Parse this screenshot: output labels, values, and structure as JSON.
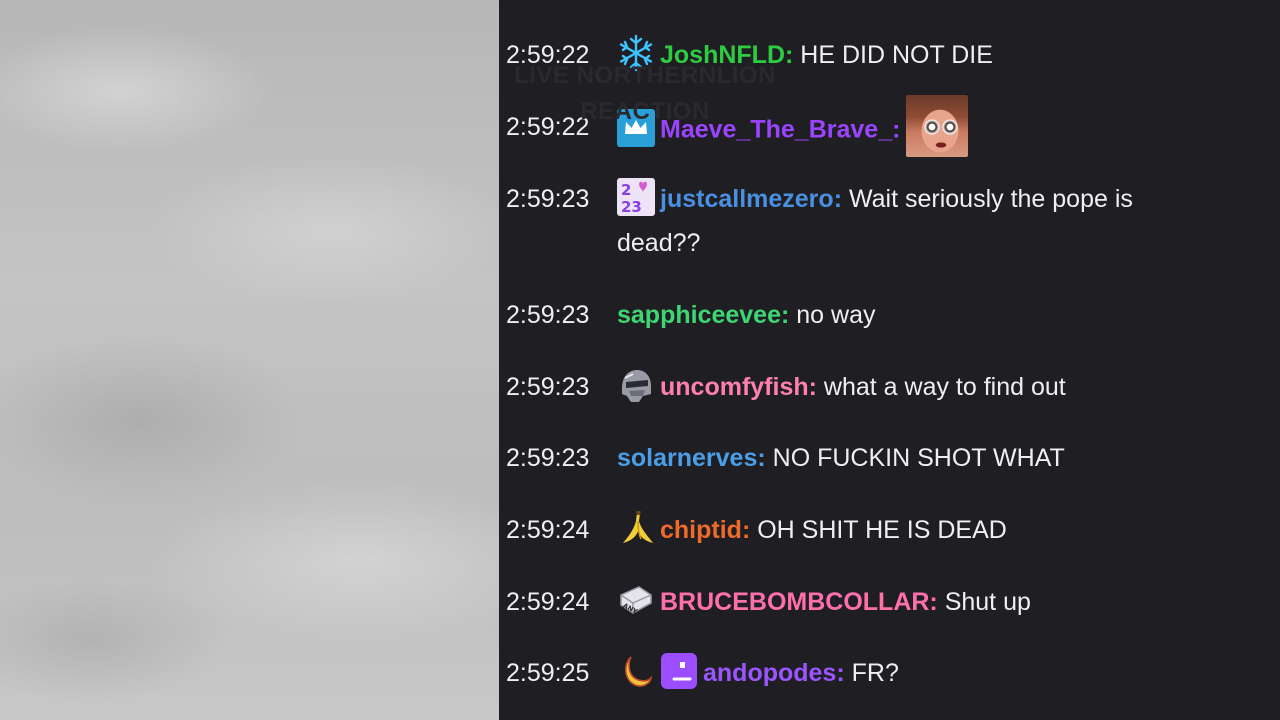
{
  "watermark": {
    "line1": "LIVE NORTHERNLION",
    "line2": "REACTION"
  },
  "messages": [
    {
      "time": "2:59:22",
      "badge_icon": "snowflake-icon",
      "name": "JoshNFLD",
      "name_color": "#2ecc40",
      "text": "HE DID NOT DIE"
    },
    {
      "time": "2:59:22",
      "badge_icon": "crown-icon",
      "name": "Maeve_The_Brave_",
      "name_color": "#9b44ff",
      "text": "",
      "emote": "face-emote"
    },
    {
      "time": "2:59:23",
      "badge_icon": "2023-badge-icon",
      "name": "justcallmezero",
      "name_color": "#4a8fe0",
      "text": "Wait seriously the pope is dead??"
    },
    {
      "time": "2:59:23",
      "badge_icon": "",
      "name": "sapphiceevee",
      "name_color": "#3ed673",
      "text": "no way"
    },
    {
      "time": "2:59:23",
      "badge_icon": "helmet-icon",
      "name": "uncomfyfish",
      "name_color": "#ff7fb0",
      "text": "what a way to find out"
    },
    {
      "time": "2:59:23",
      "badge_icon": "",
      "name": "solarnerves",
      "name_color": "#4a9ee8",
      "text": "NO FUCKIN SHOT WHAT"
    },
    {
      "time": "2:59:24",
      "badge_icon": "banana-icon",
      "name": "chiptid",
      "name_color": "#f06a2a",
      "text": "OH SHIT HE IS DEAD"
    },
    {
      "time": "2:59:24",
      "badge_icon": "any-key-icon",
      "name": "BRUCEBOMBCOLLAR",
      "name_color": "#ff6fa8",
      "text": "Shut up"
    },
    {
      "time": "2:59:25",
      "badge_icon": "moon-icon",
      "badge_icon_2": "purple-blob-icon",
      "name": "andopodes",
      "name_color": "#9b55ff",
      "text": "FR?"
    }
  ]
}
